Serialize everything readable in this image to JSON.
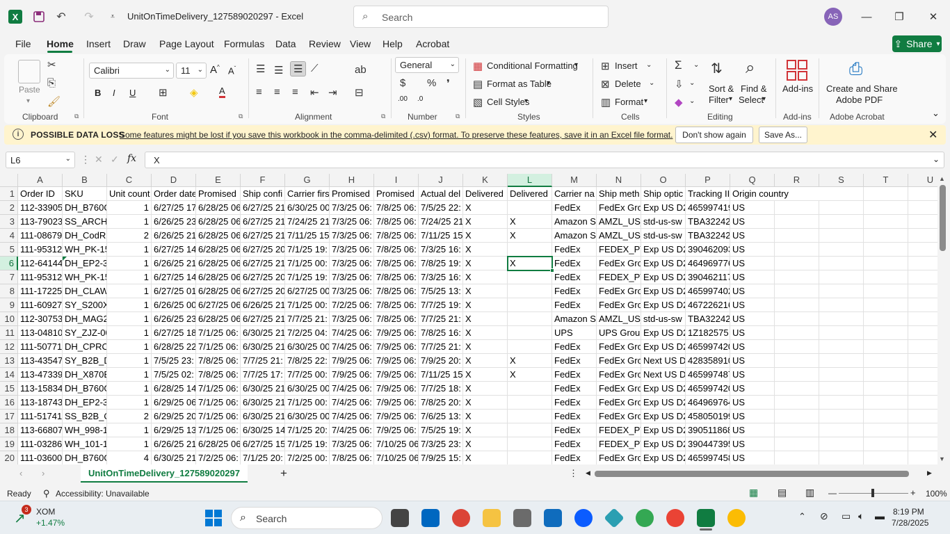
{
  "titlebar": {
    "app_icon": "X",
    "doc_title": "UnitOnTimeDelivery_127589020297  -  Excel",
    "search_placeholder": "Search",
    "avatar": "AS"
  },
  "menu": [
    "File",
    "Home",
    "Insert",
    "Draw",
    "Page Layout",
    "Formulas",
    "Data",
    "Review",
    "View",
    "Help",
    "Acrobat"
  ],
  "share_label": "Share",
  "ribbon": {
    "clipboard": {
      "paste": "Paste",
      "label": "Clipboard"
    },
    "font": {
      "name": "Calibri",
      "size": "11",
      "label": "Font"
    },
    "alignment": {
      "label": "Alignment"
    },
    "number": {
      "format": "General",
      "label": "Number"
    },
    "styles": {
      "conditional": "Conditional Formatting",
      "table": "Format as Table",
      "cell": "Cell Styles",
      "label": "Styles"
    },
    "cells": {
      "insert": "Insert",
      "delete": "Delete",
      "format": "Format",
      "label": "Cells"
    },
    "editing": {
      "sort": "Sort &",
      "filter": "Filter",
      "find": "Find &",
      "select": "Select",
      "label": "Editing"
    },
    "addins": {
      "btn": "Add-ins",
      "label": "Add-ins"
    },
    "acrobat": {
      "btn1": "Create and Share",
      "btn2": "Adobe PDF",
      "label": "Adobe Acrobat"
    }
  },
  "infobar": {
    "title": "POSSIBLE DATA LOSS",
    "message": "Some features might be lost if you save this workbook in the comma-delimited (.csv) format. To preserve these features, save it in an Excel file format.",
    "dont_show": "Don't show again",
    "save_as": "Save As..."
  },
  "formula_bar": {
    "name_box": "L6",
    "fx": "fx",
    "value": "X"
  },
  "columns": [
    "A",
    "B",
    "C",
    "D",
    "E",
    "F",
    "G",
    "H",
    "I",
    "J",
    "K",
    "L",
    "M",
    "N",
    "O",
    "P",
    "Q",
    "R",
    "S",
    "T",
    "U"
  ],
  "rows": [
    [
      "Order ID",
      "SKU",
      "Unit count",
      "Order date",
      "Promised",
      "Ship confi",
      "Carrier firs",
      "Promised",
      "Promised",
      "Actual del",
      "Delivered",
      "Delivered",
      "Carrier na",
      "Ship meth",
      "Ship optic",
      "Tracking II",
      "Origin country"
    ],
    [
      "112-33905",
      "DH_B760G",
      "1",
      "6/27/25 17",
      "6/28/25 06",
      "6/27/25 21",
      "6/30/25 00",
      "7/3/25 06:",
      "7/8/25 06:",
      "7/5/25 22:",
      "X",
      "",
      "FedEx",
      "FedEx Gro",
      "Exp US D2",
      "465997419",
      "US"
    ],
    [
      "113-79023",
      "SS_ARCHE",
      "1",
      "6/26/25 23",
      "6/28/25 06",
      "6/27/25 21",
      "7/24/25 21",
      "7/3/25 06:",
      "7/8/25 06:",
      "7/24/25 21",
      "X",
      "X",
      "Amazon S",
      "AMZL_US_",
      "std-us-sw",
      "TBA32242",
      "US"
    ],
    [
      "111-08679",
      "DH_CodR2",
      "2",
      "6/26/25 21",
      "6/28/25 06",
      "6/27/25 21",
      "7/11/25 15",
      "7/3/25 06:",
      "7/8/25 06:",
      "7/11/25 15",
      "X",
      "X",
      "Amazon S",
      "AMZL_US_",
      "std-us-sw",
      "TBA32242",
      "US"
    ],
    [
      "111-95312",
      "WH_PK-15",
      "1",
      "6/27/25 14",
      "6/28/25 06",
      "6/27/25 20",
      "7/1/25 19:",
      "7/3/25 06:",
      "7/8/25 06:",
      "7/3/25 16:",
      "X",
      "",
      "FedEx",
      "FEDEX_PT",
      "Exp US D2",
      "390462093",
      "US"
    ],
    [
      "112-64144",
      "DH_EP2-3",
      "1",
      "6/26/25 21",
      "6/28/25 06",
      "6/27/25 21",
      "7/1/25 00:",
      "7/3/25 06:",
      "7/8/25 06:",
      "7/8/25 19:",
      "X",
      "X",
      "FedEx",
      "FedEx Gro",
      "Exp US D2",
      "464969776",
      "US"
    ],
    [
      "111-95312",
      "WH_PK-15",
      "1",
      "6/27/25 14",
      "6/28/25 06",
      "6/27/25 20",
      "7/1/25 19:",
      "7/3/25 06:",
      "7/8/25 06:",
      "7/3/25 16:",
      "X",
      "",
      "FedEx",
      "FEDEX_PT",
      "Exp US D2",
      "390462117",
      "US"
    ],
    [
      "111-17225",
      "DH_CLAW",
      "1",
      "6/27/25 01",
      "6/28/25 06",
      "6/27/25 20",
      "6/27/25 00",
      "7/3/25 06:",
      "7/8/25 06:",
      "7/5/25 13:",
      "X",
      "",
      "FedEx",
      "FedEx Gro",
      "Exp US D2",
      "465997402",
      "US"
    ],
    [
      "111-60927",
      "SY_S200X2",
      "1",
      "6/26/25 00",
      "6/27/25 06",
      "6/26/25 21",
      "7/1/25 00:",
      "7/2/25 06:",
      "7/8/25 06:",
      "7/7/25 19:",
      "X",
      "",
      "FedEx",
      "FedEx Gro",
      "Exp US D2",
      "467226216",
      "US"
    ],
    [
      "112-30753",
      "DH_MAG2",
      "1",
      "6/26/25 23",
      "6/28/25 06",
      "6/27/25 21",
      "7/7/25 21:",
      "7/3/25 06:",
      "7/8/25 06:",
      "7/7/25 21:",
      "X",
      "",
      "Amazon S",
      "AMZL_US_",
      "std-us-sw",
      "TBA32242",
      "US"
    ],
    [
      "113-04810",
      "SY_ZJZ-00",
      "1",
      "6/27/25 18",
      "7/1/25 06:",
      "6/30/25 21",
      "7/2/25 04:",
      "7/4/25 06:",
      "7/9/25 06:",
      "7/8/25 16:",
      "X",
      "",
      "UPS",
      "UPS Grour",
      "Exp US D2",
      "1Z182575",
      "US"
    ],
    [
      "111-50771",
      "DH_CPROI",
      "1",
      "6/28/25 22",
      "7/1/25 06:",
      "6/30/25 21",
      "6/30/25 00",
      "7/4/25 06:",
      "7/9/25 06:",
      "7/7/25 21:",
      "X",
      "",
      "FedEx",
      "FedEx Gro",
      "Exp US D2",
      "465997420",
      "US"
    ],
    [
      "113-43547",
      "SY_B2B_D",
      "1",
      "7/5/25 23:",
      "7/8/25 06:",
      "7/7/25 21:",
      "7/8/25 22:",
      "7/9/25 06:",
      "7/9/25 06:",
      "7/9/25 20:",
      "X",
      "X",
      "FedEx",
      "FedEx Gro",
      "Next US D",
      "428358910",
      "US"
    ],
    [
      "113-47339",
      "DH_X870E",
      "1",
      "7/5/25 02:",
      "7/8/25 06:",
      "7/7/25 17:",
      "7/7/25 00:",
      "7/9/25 06:",
      "7/9/25 06:",
      "7/11/25 15",
      "X",
      "X",
      "FedEx",
      "FedEx Gro",
      "Next US D",
      "465997487",
      "US"
    ],
    [
      "113-15834",
      "DH_B760G",
      "1",
      "6/28/25 14",
      "7/1/25 06:",
      "6/30/25 21",
      "6/30/25 00",
      "7/4/25 06:",
      "7/9/25 06:",
      "7/7/25 18:",
      "X",
      "",
      "FedEx",
      "FedEx Gro",
      "Exp US D2",
      "465997420",
      "US"
    ],
    [
      "113-18743",
      "DH_EP2-3",
      "1",
      "6/29/25 06",
      "7/1/25 06:",
      "6/30/25 21",
      "7/1/25 00:",
      "7/4/25 06:",
      "7/9/25 06:",
      "7/8/25 20:",
      "X",
      "",
      "FedEx",
      "FedEx Gro",
      "Exp US D2",
      "464969764",
      "US"
    ],
    [
      "111-51741",
      "SS_B2B_Q",
      "2",
      "6/29/25 20",
      "7/1/25 06:",
      "6/30/25 21",
      "6/30/25 00",
      "7/4/25 06:",
      "7/9/25 06:",
      "7/6/25 13:",
      "X",
      "",
      "FedEx",
      "FedEx Gro",
      "Exp US D2",
      "458050199",
      "US"
    ],
    [
      "113-66807",
      "WH_998-1",
      "1",
      "6/29/25 13",
      "7/1/25 06:",
      "6/30/25 14",
      "7/1/25 20:",
      "7/4/25 06:",
      "7/9/25 06:",
      "7/5/25 19:",
      "X",
      "",
      "FedEx",
      "FEDEX_PT",
      "Exp US D2",
      "390511868",
      "US"
    ],
    [
      "111-03286",
      "WH_101-1",
      "1",
      "6/26/25 21",
      "6/28/25 06",
      "6/27/25 15",
      "7/1/25 19:",
      "7/3/25 06:",
      "7/10/25 06",
      "7/3/25 23:",
      "X",
      "",
      "FedEx",
      "FEDEX_PT",
      "Exp US D2",
      "390447395",
      "US"
    ],
    [
      "111-03600",
      "DH_B760G",
      "4",
      "6/30/25 21",
      "7/2/25 06:",
      "7/1/25 20:",
      "7/2/25 00:",
      "7/8/25 06:",
      "7/10/25 06",
      "7/9/25 15:",
      "X",
      "",
      "FedEx",
      "FedEx Gro",
      "Exp US D2",
      "465997458",
      "US"
    ]
  ],
  "sheet_tab": "UnitOnTimeDelivery_127589020297",
  "status": {
    "ready": "Ready",
    "accessibility": "Accessibility: Unavailable",
    "zoom": "100%"
  },
  "taskbar": {
    "stock_badge": "3",
    "stock_name": "XOM",
    "stock_change": "+1.47%",
    "search": "Search",
    "time": "8:19 PM",
    "date": "7/28/2025"
  },
  "colors": {
    "accent": "#107c41",
    "infobar": "#fff4ce"
  }
}
